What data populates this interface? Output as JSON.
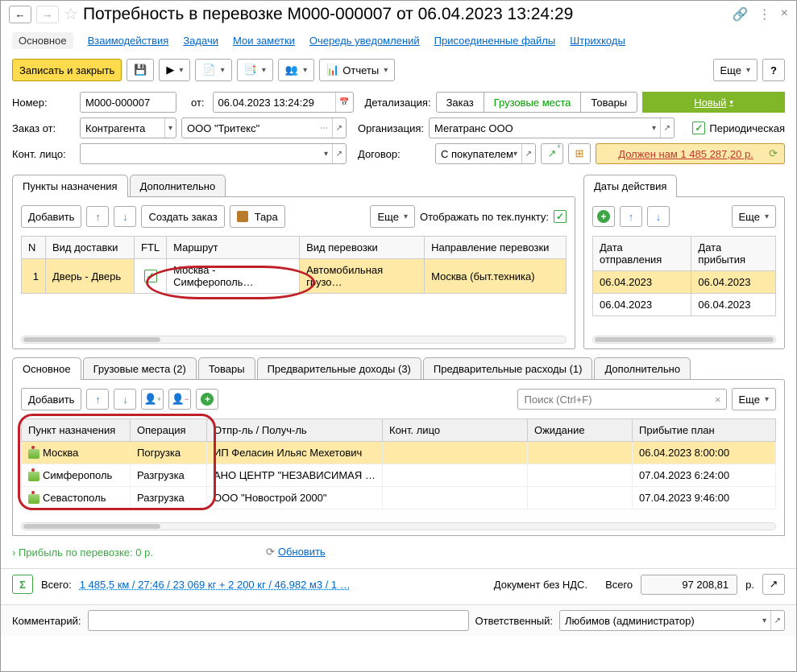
{
  "title": "Потребность в перевозке М000-000007 от 06.04.2023 13:24:29",
  "nav": [
    "Основное",
    "Взаимодействия",
    "Задачи",
    "Мои заметки",
    "Очередь уведомлений",
    "Присоединенные файлы",
    "Штрихкоды"
  ],
  "toolbar": {
    "save_close": "Записать и закрыть",
    "reports": "Отчеты",
    "more": "Еще"
  },
  "labels": {
    "number": "Номер:",
    "from": "от:",
    "detail": "Детализация:",
    "order_from": "Заказ от:",
    "org": "Организация:",
    "contact": "Конт. лицо:",
    "contract": "Договор:",
    "periodic": "Периодическая",
    "display_by_point": "Отображать по тек.пункту:",
    "dates_section": "Даты действия",
    "dep_date": "Дата отправления",
    "arr_date": "Дата прибытия",
    "comment": "Комментарий:",
    "responsible": "Ответственный:"
  },
  "fields": {
    "number": "М000-000007",
    "date": "06.04.2023 13:24:29",
    "order_from": "Контрагента",
    "counterparty": "ООО \"Тритекс\"",
    "org": "Мегатранс ООО",
    "contact": "",
    "contract": "С покупателем",
    "responsible": "Любимов (администратор)",
    "comment": ""
  },
  "detail_segments": [
    "Заказ",
    "Грузовые места",
    "Товары"
  ],
  "status": "Новый",
  "debt": "Должен нам 1 485 287,20 р.",
  "points_tabs": [
    "Пункты назначения",
    "Дополнительно"
  ],
  "points_toolbar": {
    "add": "Добавить",
    "create_order": "Создать заказ",
    "tare": "Тара",
    "more": "Еще"
  },
  "points_headers": [
    "N",
    "Вид доставки",
    "FTL",
    "Маршрут",
    "Вид перевозки",
    "Направление перевозки"
  ],
  "points_rows": [
    {
      "n": "1",
      "delivery": "Дверь - Дверь",
      "ftl": true,
      "route": "Москва - Симферополь…",
      "type": "Автомобильная грузо…",
      "direction": "Москва (быт.техника)"
    }
  ],
  "dates_rows": [
    {
      "dep": "06.04.2023",
      "arr": "06.04.2023"
    },
    {
      "dep": "06.04.2023",
      "arr": "06.04.2023"
    }
  ],
  "lower_tabs": [
    "Основное",
    "Грузовые места (2)",
    "Товары",
    "Предварительные доходы (3)",
    "Предварительные расходы (1)",
    "Дополнительно"
  ],
  "lower_toolbar": {
    "add": "Добавить",
    "search_placeholder": "Поиск (Ctrl+F)",
    "more": "Еще"
  },
  "lower_headers": [
    "Пункт назначения",
    "Операция",
    "Отпр-ль / Получ-ль",
    "Конт. лицо",
    "Ожидание",
    "Прибытие план"
  ],
  "lower_rows": [
    {
      "point": "Москва",
      "op": "Погрузка",
      "party": "ИП Феласин Ильяс Мехетович",
      "contact": "",
      "wait": "",
      "arrival": "06.04.2023 8:00:00"
    },
    {
      "point": "Симферополь",
      "op": "Разгрузка",
      "party": "АНО ЦЕНТР \"НЕЗАВИСИМАЯ …",
      "contact": "",
      "wait": "",
      "arrival": "07.04.2023 6:24:00"
    },
    {
      "point": "Севастополь",
      "op": "Разгрузка",
      "party": "ООО \"Новострой 2000\"",
      "contact": "",
      "wait": "",
      "arrival": "07.04.2023 9:46:00"
    }
  ],
  "profit": "Прибыль по перевозке: 0 р.",
  "refresh": "Обновить",
  "totals": {
    "label": "Всего:",
    "link": "1 485,5 км / 27:46 / 23 069 кг + 2 200 кг / 46,982 м3 / 1 …",
    "vat": "Документ без НДС.",
    "total_label": "Всего",
    "amount": "97 208,81",
    "currency": "р."
  }
}
